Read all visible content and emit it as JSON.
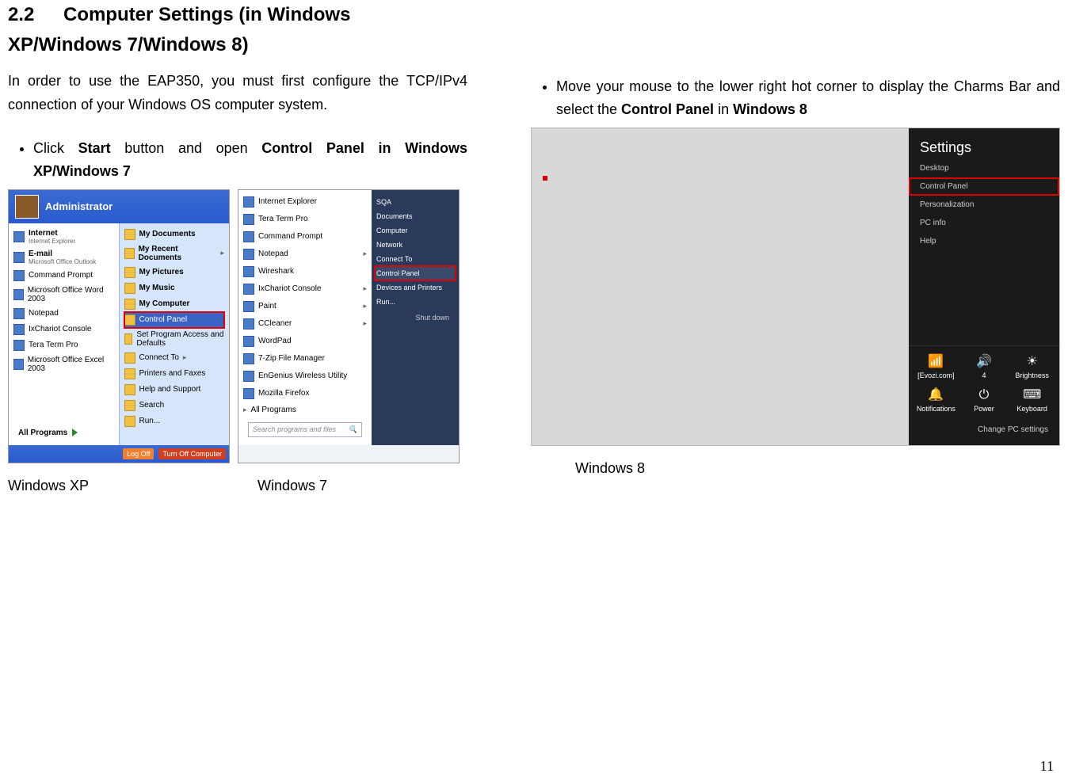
{
  "section": {
    "number": "2.2",
    "title": "Computer Settings (in Windows XP/Windows 7/Windows 8)"
  },
  "intro": "In order to use the EAP350, you must first configure the TCP/IPv4 connection of your Windows OS computer system.",
  "bullet_left_pre": "Click ",
  "bullet_left_b1": "Start",
  "bullet_left_mid": " button and open ",
  "bullet_left_b2": "Control Panel in Windows XP/Windows 7",
  "caption_xp": "Windows XP",
  "caption_w7": "Windows 7",
  "xp": {
    "admin": "Administrator",
    "left": [
      "Internet",
      "E-mail",
      "Command Prompt",
      "Microsoft Office Word 2003",
      "Notepad",
      "IxChariot Console",
      "Tera Term Pro",
      "Microsoft Office Excel 2003"
    ],
    "left_sub": [
      "Internet Explorer",
      "Microsoft Office Outlook"
    ],
    "right": [
      "My Documents",
      "My Recent Documents",
      "My Pictures",
      "My Music",
      "My Computer",
      "Control Panel",
      "Set Program Access and Defaults",
      "Connect To",
      "Printers and Faxes",
      "Help and Support",
      "Search",
      "Run..."
    ],
    "allprog": "All Programs",
    "logoff": "Log Off",
    "turnoff": "Turn Off Computer"
  },
  "w7": {
    "left": [
      "Internet Explorer",
      "Tera Term Pro",
      "Command Prompt",
      "Notepad",
      "Wireshark",
      "IxChariot Console",
      "Paint",
      "CCleaner",
      "WordPad",
      "7-Zip File Manager",
      "EnGenius Wireless Utility",
      "Mozilla Firefox",
      "All Programs"
    ],
    "right": [
      "SQA",
      "Documents",
      "Computer",
      "Network",
      "Connect To",
      "Control Panel",
      "Devices and Printers",
      "Run..."
    ],
    "search": "Search programs and files",
    "shutdown": "Shut down"
  },
  "bullet_right_pre": "Move your mouse to the lower right hot corner to display the Charms Bar and select the ",
  "bullet_right_b1": "Control Panel",
  "bullet_right_mid": " in ",
  "bullet_right_b2": "Windows 8",
  "caption_w8": "Windows 8",
  "w8": {
    "heading": "Settings",
    "links": [
      "Desktop",
      "Control Panel",
      "Personalization",
      "PC info",
      "Help"
    ],
    "controls": [
      {
        "icon": "📶",
        "label": "[Evozi.com]"
      },
      {
        "icon": "🔊",
        "label": "4"
      },
      {
        "icon": "☀",
        "label": "Brightness"
      },
      {
        "icon": "🔔",
        "label": "Notifications"
      },
      {
        "icon": "⏻",
        "label": "Power"
      },
      {
        "icon": "⌨",
        "label": "Keyboard"
      }
    ],
    "change": "Change PC settings"
  },
  "page": "11"
}
